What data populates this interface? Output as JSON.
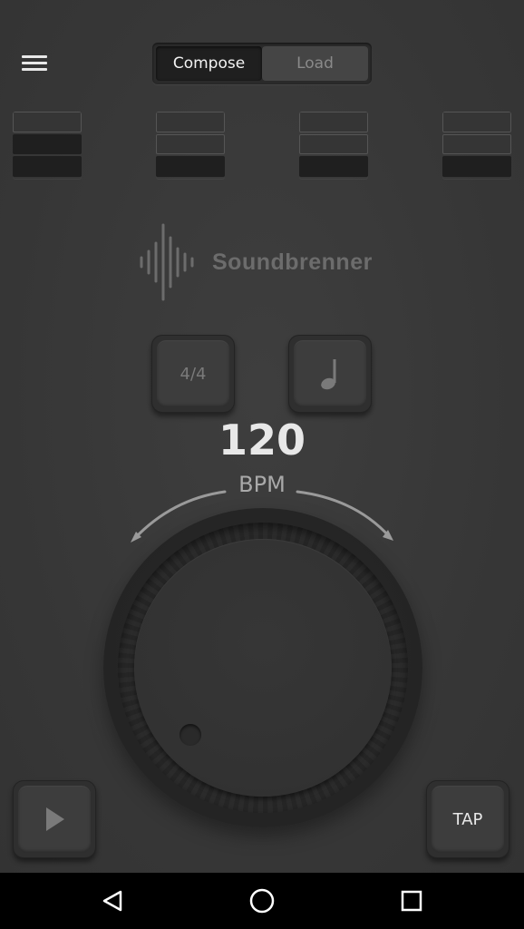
{
  "header": {
    "menu_icon": "hamburger-icon",
    "toggle": {
      "compose": "Compose",
      "load": "Load",
      "selected": "Compose"
    }
  },
  "beats": [
    {
      "levels": [
        "off",
        "on",
        "on"
      ]
    },
    {
      "levels": [
        "off",
        "off",
        "on"
      ]
    },
    {
      "levels": [
        "off",
        "off",
        "on"
      ]
    },
    {
      "levels": [
        "off",
        "off",
        "on"
      ]
    }
  ],
  "logo": {
    "text": "Soundbrenner"
  },
  "controls": {
    "time_signature": "4/4",
    "subdivision_icon": "quarter-note-icon",
    "bpm_value": "120",
    "bpm_label": "BPM",
    "tap_label": "TAP",
    "play_icon": "play-icon"
  },
  "navbar": {
    "back_icon": "back-icon",
    "home_icon": "home-icon",
    "recents_icon": "recents-icon"
  },
  "colors": {
    "background": "#3a3a3a",
    "text_primary": "#e8e8e8",
    "text_muted": "#8a8a8a"
  }
}
